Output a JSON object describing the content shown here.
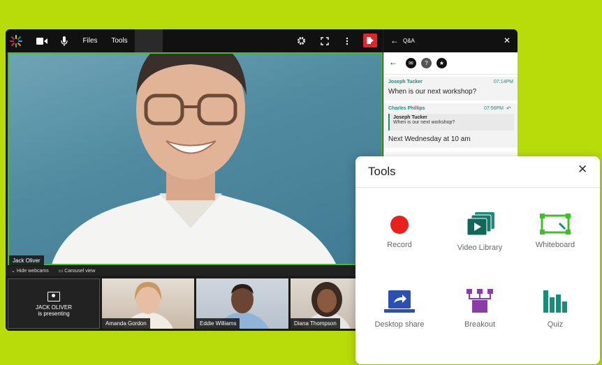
{
  "toolbar": {
    "files_label": "Files",
    "tools_label": "Tools"
  },
  "main_video": {
    "speaker_name": "Jack Oliver"
  },
  "webcam_strip": {
    "hide_label": "Hide webcams",
    "carousel_label": "Carousel view",
    "presenter_line1": "JACK OLIVER",
    "presenter_line2": "is presenting",
    "participants": [
      "Amanda Gordon",
      "Eddie Williams",
      "Diana Thompson"
    ]
  },
  "qa": {
    "title": "Q&A",
    "round_icons": [
      "✉",
      "?",
      "★"
    ],
    "messages": [
      {
        "author": "Joseph Tucker",
        "time": "07:14PM",
        "text": "When is our next workshop?"
      },
      {
        "author": "Charles Phillips",
        "time": "07:56PM",
        "quote_author": "Joseph Tucker",
        "quote_text": "When is our next workshop?",
        "text": "Next Wednesday at 10 am"
      }
    ]
  },
  "tools_panel": {
    "title": "Tools",
    "items": [
      "Record",
      "Video Library",
      "Whiteboard",
      "Desktop share",
      "Breakout",
      "Quiz"
    ]
  },
  "colors": {
    "background": "#b7dc0a",
    "accent_green": "#3fbf2a",
    "record_red": "#e8211f",
    "exit_red": "#e0262b",
    "teal": "#1a8c7a",
    "blue": "#2a4fb5",
    "purple": "#8a3da6"
  }
}
